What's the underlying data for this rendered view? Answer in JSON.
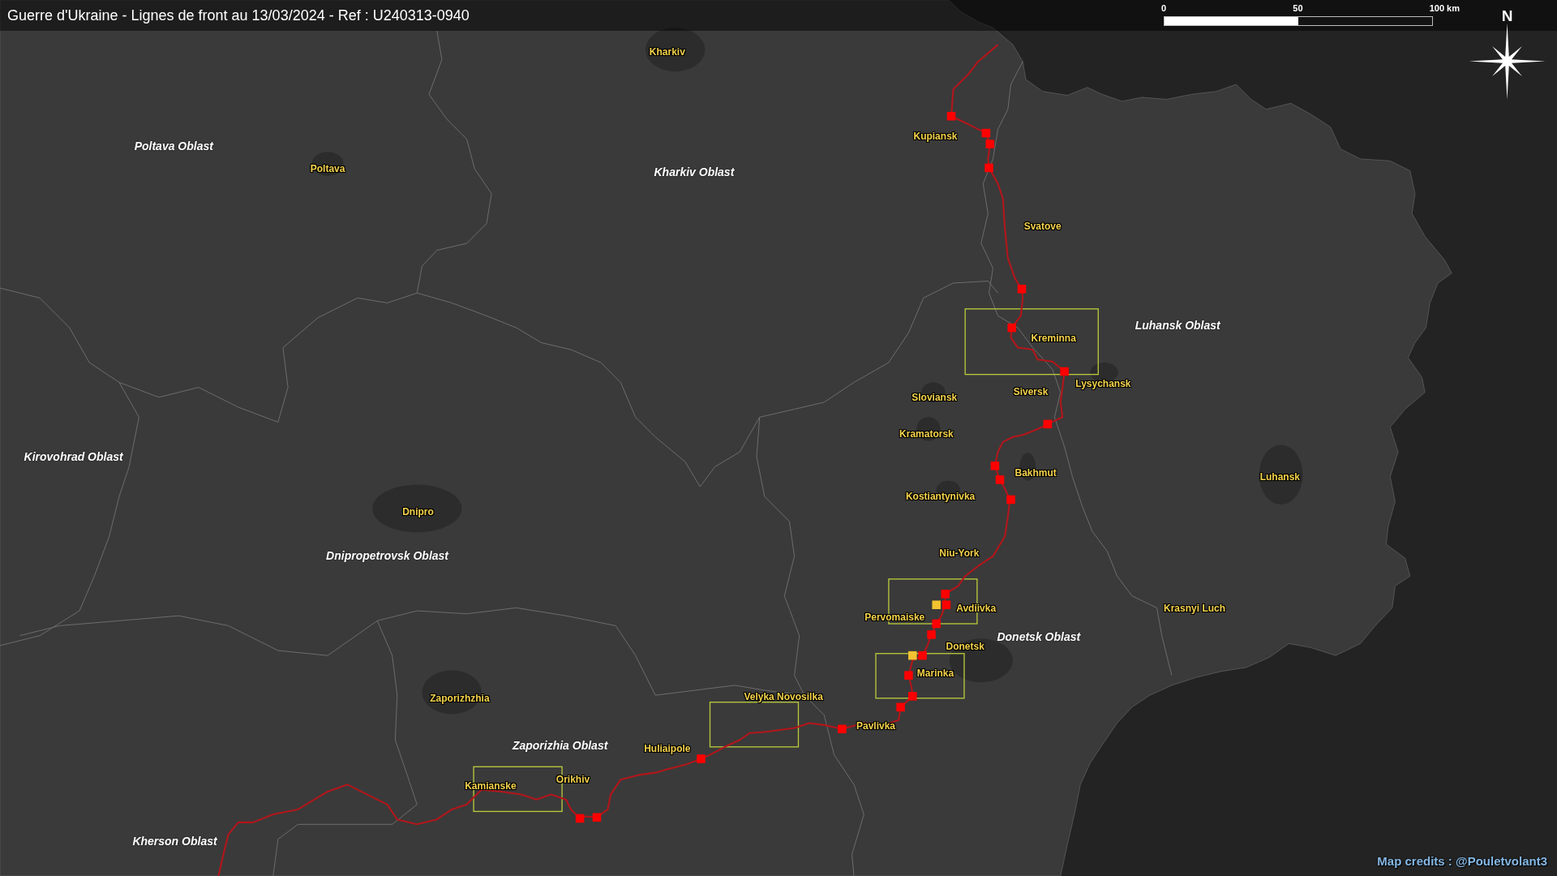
{
  "title": "Guerre d'Ukraine - Lignes de front au 13/03/2024 - Ref : U240313-0940",
  "scale_bar": {
    "labels": [
      "0",
      "50",
      "100 km"
    ]
  },
  "compass": {
    "label": "N"
  },
  "labels": [
    {
      "text": "Kharkiv",
      "kind": "city"
    },
    {
      "text": "Kupiansk",
      "kind": "city"
    },
    {
      "text": "Poltava Oblast",
      "kind": "oblast"
    },
    {
      "text": "Poltava",
      "kind": "city"
    },
    {
      "text": "Kharkiv Oblast",
      "kind": "oblast"
    },
    {
      "text": "Svatove",
      "kind": "city"
    },
    {
      "text": "Luhansk Oblast",
      "kind": "oblast"
    },
    {
      "text": "Kreminna",
      "kind": "city"
    },
    {
      "text": "Lysychansk",
      "kind": "city"
    },
    {
      "text": "Siversk",
      "kind": "city"
    },
    {
      "text": "Sloviansk",
      "kind": "city"
    },
    {
      "text": "Kramatorsk",
      "kind": "city"
    },
    {
      "text": "Kirovohrad Oblast",
      "kind": "oblast"
    },
    {
      "text": "Bakhmut",
      "kind": "city"
    },
    {
      "text": "Luhansk",
      "kind": "city"
    },
    {
      "text": "Kostiantynivka",
      "kind": "city"
    },
    {
      "text": "Dnipro",
      "kind": "city"
    },
    {
      "text": "Niu-York",
      "kind": "city"
    },
    {
      "text": "Dnipropetrovsk Oblast",
      "kind": "oblast"
    },
    {
      "text": "Avdiivka",
      "kind": "city"
    },
    {
      "text": "Krasnyi Luch",
      "kind": "city"
    },
    {
      "text": "Pervomaiske",
      "kind": "city"
    },
    {
      "text": "Donetsk Oblast",
      "kind": "oblast"
    },
    {
      "text": "Donetsk",
      "kind": "city"
    },
    {
      "text": "Marinka",
      "kind": "city"
    },
    {
      "text": "Zaporizhzhia",
      "kind": "city"
    },
    {
      "text": "Velyka Novosilka",
      "kind": "city"
    },
    {
      "text": "Pavlivka",
      "kind": "city"
    },
    {
      "text": "Zaporizhia Oblast",
      "kind": "oblast"
    },
    {
      "text": "Huliaipole",
      "kind": "city"
    },
    {
      "text": "Orikhiv",
      "kind": "city"
    },
    {
      "text": "Kamianske",
      "kind": "city"
    },
    {
      "text": "Kherson Oblast",
      "kind": "oblast"
    }
  ],
  "markers": [
    {
      "color": "#ff0000"
    },
    {
      "color": "#ff0000"
    },
    {
      "color": "#ff0000"
    },
    {
      "color": "#ff0000"
    },
    {
      "color": "#ff0000"
    },
    {
      "color": "#ff0000"
    },
    {
      "color": "#ff0000"
    },
    {
      "color": "#ff0000"
    },
    {
      "color": "#ff0000"
    },
    {
      "color": "#ff0000"
    },
    {
      "color": "#ff0000"
    },
    {
      "color": "#ff0000"
    },
    {
      "color": "#f2c230"
    },
    {
      "color": "#ff0000"
    },
    {
      "color": "#ff0000"
    },
    {
      "color": "#ff0000"
    },
    {
      "color": "#f2c230"
    },
    {
      "color": "#ff0000"
    },
    {
      "color": "#ff0000"
    },
    {
      "color": "#ff0000"
    },
    {
      "color": "#ff0000"
    },
    {
      "color": "#ff0000"
    },
    {
      "color": "#ff0000"
    },
    {
      "color": "#ff0000"
    },
    {
      "color": "#ff0000"
    }
  ],
  "credits": "Map credits : @Pouletvolant3"
}
